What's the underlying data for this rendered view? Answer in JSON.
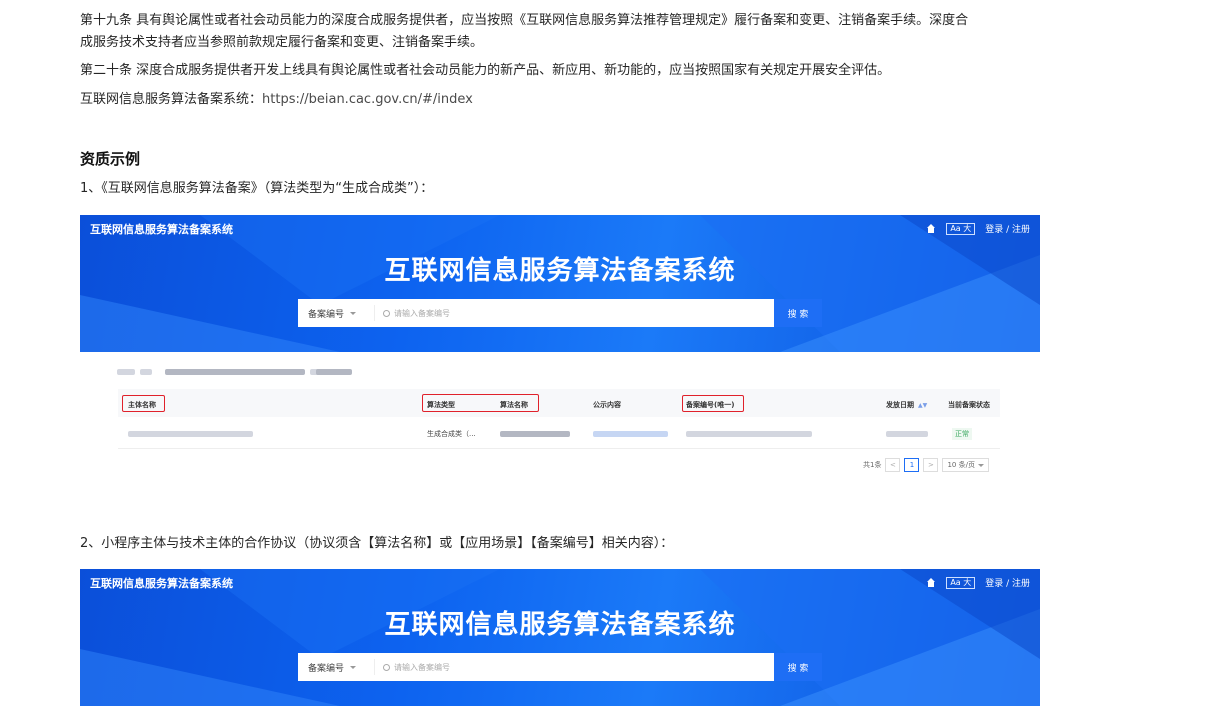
{
  "article": {
    "para1_line1": "第十九条 具有舆论属性或者社会动员能力的深度合成服务提供者，应当按照《互联网信息服务算法推荐管理规定》履行备案和变更、注销备案手续。深度合",
    "para1_line2": "成服务技术支持者应当参照前款规定履行备案和变更、注销备案手续。",
    "para2": "第二十条 深度合成服务提供者开发上线具有舆论属性或者社会动员能力的新产品、新应用、新功能的，应当按照国家有关规定开展安全评估。",
    "para3_label": "互联网信息服务算法备案系统：",
    "para3_link": "https://beian.cac.gov.cn/#/index",
    "section_title": "资质示例",
    "item1": "1、《互联网信息服务算法备案》（算法类型为“生成合成类”）：",
    "item2": "2、小程序主体与技术主体的合作协议（协议须含【算法名称】或【应用场景】【备案编号】相关内容）："
  },
  "banner": {
    "logo": "互联网信息服务算法备案系统",
    "font_toggle": "Aa 大",
    "login": "登录 / 注册",
    "title": "互联网信息服务算法备案系统",
    "select_label": "备案编号",
    "search_placeholder": "请输入备案编号",
    "search_button": "搜 索"
  },
  "results": {
    "headers": {
      "entity": "主体名称",
      "algo_type": "算法类型",
      "algo_name": "算法名称",
      "public": "公示内容",
      "record_no": "备案编号(唯一)",
      "issue_date": "发放日期",
      "status": "当前备案状态"
    },
    "row": {
      "algo_type": "生成合成类（...",
      "status": "正常"
    },
    "pager": {
      "total": "共1条",
      "prev": "<",
      "page": "1",
      "next": ">",
      "page_size": "10 条/页"
    }
  },
  "colors": {
    "banner_blue": "#0d63f0",
    "highlight_red": "#e0212b",
    "status_green": "#3aa860"
  },
  "icons": [
    "home-icon",
    "search-icon",
    "chevron-down-icon",
    "sort-icon"
  ]
}
